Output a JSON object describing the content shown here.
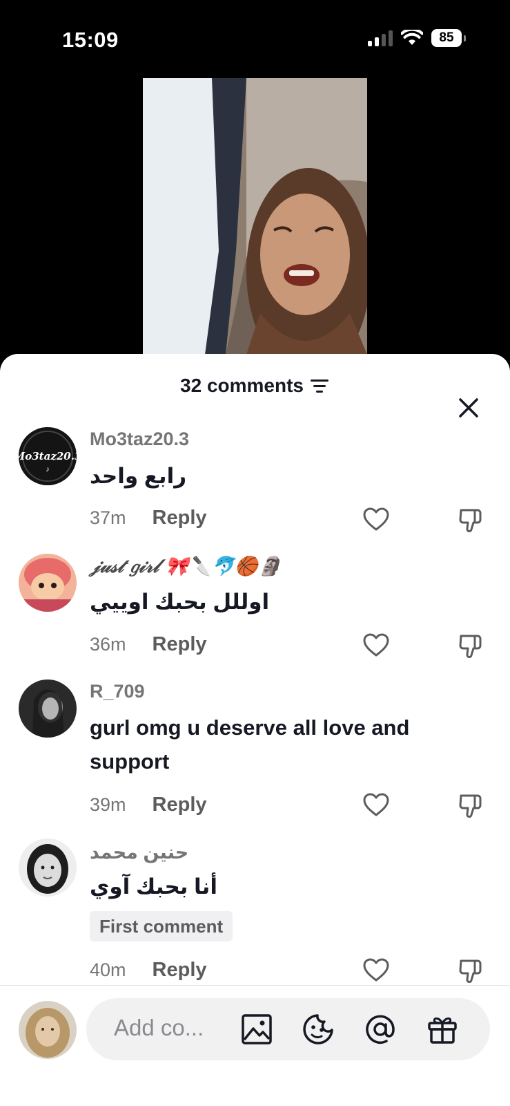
{
  "status_bar": {
    "time": "15:09",
    "battery": "85"
  },
  "sheet": {
    "title": "32 comments",
    "filter_icon": "filter-icon",
    "close_icon": "close-icon"
  },
  "comments": [
    {
      "username": "Mo3taz20.3",
      "text": "رابع واحد",
      "time": "37m",
      "reply": "Reply",
      "avatar_text": "Mo3taz20.3"
    },
    {
      "username": "𝒿𝓊𝓈𝓉 𝑔𝒾𝓇𝓁 🎀🔪🐬🏀🗿",
      "text": "اوللل بحبك اوييي",
      "time": "36m",
      "reply": "Reply"
    },
    {
      "username": "R_709",
      "text": "gurl omg u deserve all love and support",
      "time": "39m",
      "reply": "Reply"
    },
    {
      "username": "حنين محمد",
      "text": "أنا بحبك آوي",
      "badge": "First comment",
      "time": "40m",
      "reply": "Reply"
    }
  ],
  "composer": {
    "placeholder": "Add co...",
    "icons": [
      "image-icon",
      "emoji-icon",
      "mention-icon",
      "gift-icon"
    ]
  },
  "colors": {
    "sheet_bg": "#ffffff",
    "text_primary": "#161823",
    "text_secondary": "#757575",
    "input_bg": "#f1f1f2"
  }
}
